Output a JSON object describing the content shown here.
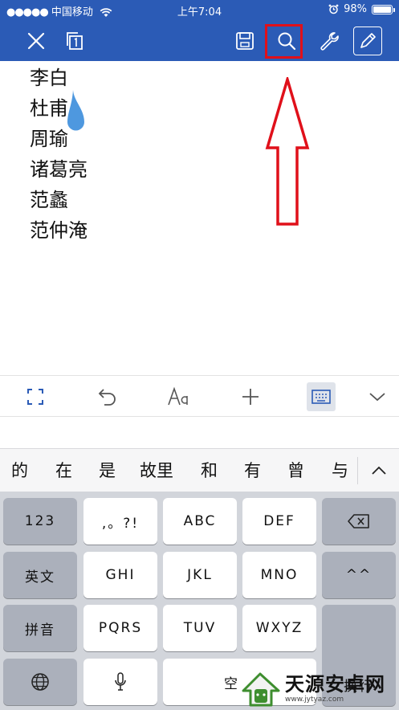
{
  "status_bar": {
    "carrier": "中国移动",
    "time": "上午7:04",
    "battery": "98%",
    "battery_level": 0.98
  },
  "toolbar": {
    "icons": [
      "close-icon",
      "copy-icon",
      "save-icon",
      "search-icon",
      "wrench-icon",
      "pen-icon"
    ],
    "accent": "#2b5bb6",
    "highlight_color": "#e0101a"
  },
  "document": {
    "lines": [
      "李白",
      "杜甫",
      "周瑜",
      "诸葛亮",
      "范蠡",
      "范仲淹"
    ]
  },
  "format_toolbar": {
    "icons": [
      "fullscreen-icon",
      "undo-icon",
      "font-icon",
      "add-icon",
      "keyboard-icon",
      "chevron-down-icon"
    ]
  },
  "candidates": [
    "的",
    "在",
    "是",
    "故里",
    "和",
    "有",
    "曾",
    "与"
  ],
  "keyboard": {
    "row1": [
      "123",
      ",。?!",
      "ABC",
      "DEF"
    ],
    "row2": [
      "英文",
      "GHI",
      "JKL",
      "MNO",
      "^^"
    ],
    "row3": [
      "拼音",
      "PQRS",
      "TUV",
      "WXYZ"
    ],
    "enter": "换行",
    "space": "空",
    "watermark": "天源安卓网",
    "watermark_url": "www.jytyaz.com"
  }
}
